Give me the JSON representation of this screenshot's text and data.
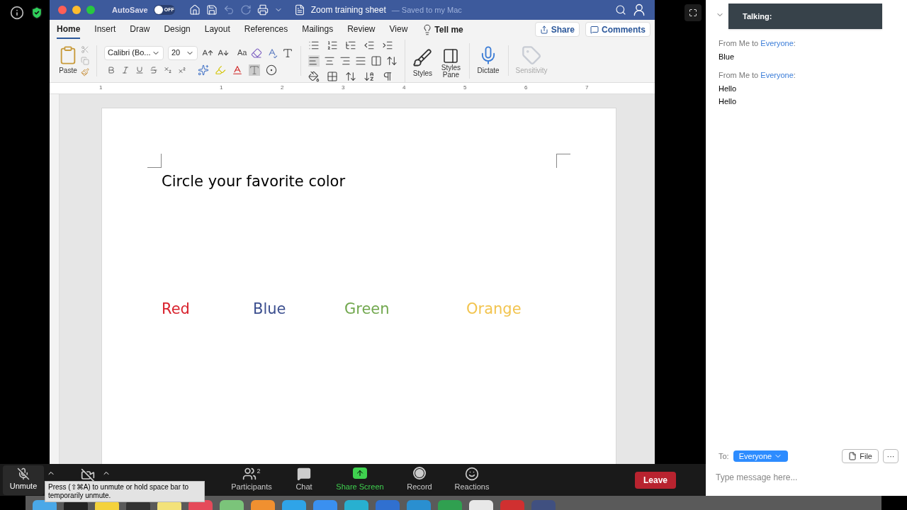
{
  "word": {
    "title_bar": {
      "autosave_label": "AutoSave",
      "autosave": {
        "on": false,
        "label": "OFF"
      },
      "doc_title": "Zoom training sheet",
      "status": "— Saved to my Mac"
    },
    "tabs": [
      {
        "label": "Home",
        "selected": true
      },
      {
        "label": "Insert",
        "selected": false
      },
      {
        "label": "Draw",
        "selected": false
      },
      {
        "label": "Design",
        "selected": false
      },
      {
        "label": "Layout",
        "selected": false
      },
      {
        "label": "References",
        "selected": false
      },
      {
        "label": "Mailings",
        "selected": false
      },
      {
        "label": "Review",
        "selected": false
      },
      {
        "label": "View",
        "selected": false
      }
    ],
    "tell_me": "Tell me",
    "share": "Share",
    "comments": "Comments",
    "ribbon": {
      "paste": "Paste",
      "font": "Calibri (Bo...",
      "size": "20",
      "case": "Aa",
      "styles": "Styles",
      "styles_pane": "Styles Pane",
      "dictate": "Dictate",
      "sensitivity": {
        "label": "Sensitivity",
        "disabled": true
      }
    },
    "ruler": [
      "1",
      "1",
      "2",
      "3",
      "4",
      "5",
      "6",
      "7"
    ],
    "document": {
      "heading": "Circle your favorite color",
      "choices": [
        {
          "label": "Red",
          "color": "#d9232e"
        },
        {
          "label": "Blue",
          "color": "#3c4f8f"
        },
        {
          "label": "Green",
          "color": "#72a84f"
        },
        {
          "label": "Orange",
          "color": "#f2c44f"
        }
      ]
    }
  },
  "toolbar": {
    "audio": {
      "muted": true,
      "label": "Unmute"
    },
    "video": {
      "off": true
    },
    "tooltip": "Press  (⇧⌘A) to unmute or hold space bar to temporarily unmute.",
    "participants": {
      "label": "Participants",
      "count": "2"
    },
    "chat": "Chat",
    "share_screen": "Share Screen",
    "record": "Record",
    "reactions": "Reactions",
    "leave": "Leave"
  },
  "chat": {
    "talking": "Talking:",
    "messages": [
      {
        "sender": "From Me to ",
        "recipient": "Everyone",
        "suffix": ":",
        "lines": [
          "Blue"
        ]
      },
      {
        "sender": "From Me to ",
        "recipient": "Everyone",
        "suffix": ":",
        "lines": [
          "Hello",
          "Hello"
        ]
      }
    ],
    "to_label": "To:",
    "recipient": "Everyone",
    "file": "File",
    "more": "···",
    "placeholder": "Type message here..."
  }
}
